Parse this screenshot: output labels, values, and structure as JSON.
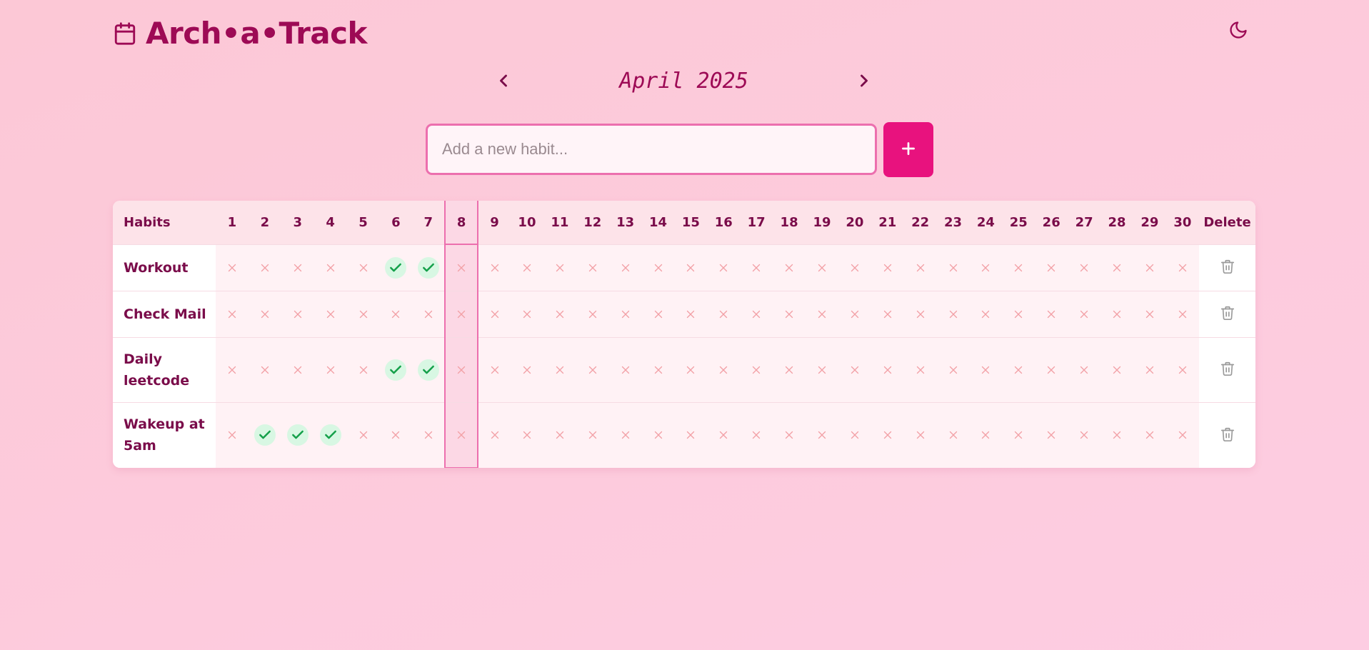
{
  "app": {
    "title": "Arch•a•Track",
    "icons": {
      "logo": "calendar-icon",
      "theme": "moon-icon"
    }
  },
  "nav": {
    "month": "April 2025",
    "prev_icon": "chevron-left-icon",
    "next_icon": "chevron-right-icon"
  },
  "add": {
    "placeholder": "Add a new habit...",
    "value": "",
    "button_icon": "plus-icon"
  },
  "table": {
    "habits_header": "Habits",
    "delete_header": "Delete",
    "today": 8,
    "days": [
      "1",
      "2",
      "3",
      "4",
      "5",
      "6",
      "7",
      "8",
      "9",
      "10",
      "11",
      "12",
      "13",
      "14",
      "15",
      "16",
      "17",
      "18",
      "19",
      "20",
      "21",
      "22",
      "23",
      "24",
      "25",
      "26",
      "27",
      "28",
      "29",
      "30"
    ],
    "rows": [
      {
        "name": "Workout",
        "done": [
          6,
          7
        ]
      },
      {
        "name": "Check Mail",
        "done": []
      },
      {
        "name": "Daily leetcode",
        "done": [
          6,
          7
        ]
      },
      {
        "name": "Wakeup at 5am",
        "done": [
          2,
          3,
          4
        ]
      }
    ]
  },
  "colors": {
    "accent": "#e8127e",
    "brand": "#9d0a55",
    "done": "#14a04a",
    "miss": "#f2a0a6"
  }
}
